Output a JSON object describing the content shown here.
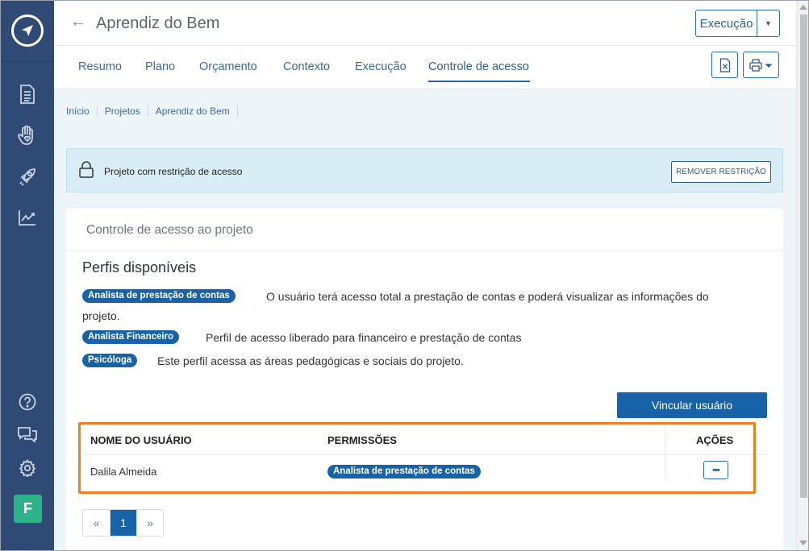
{
  "header": {
    "title": "Aprendiz do Bem",
    "status_button": "Execução"
  },
  "tabs": [
    {
      "label": "Resumo"
    },
    {
      "label": "Plano"
    },
    {
      "label": "Orçamento"
    },
    {
      "label": "Contexto"
    },
    {
      "label": "Execução"
    },
    {
      "label": "Controle de acesso",
      "active": true
    }
  ],
  "breadcrumb": [
    "Início",
    "Projetos",
    "Aprendiz do Bem"
  ],
  "alert": {
    "message": "Projeto com restrição de acesso",
    "button": "REMOVER RESTRIÇÃO"
  },
  "card": {
    "title": "Controle de acesso ao projeto",
    "profiles_title": "Perfis disponíveis",
    "profiles": [
      {
        "name": "Analista de prestação de contas",
        "description": "O usuário terá acesso total a prestação de contas e poderá visualizar as informações do",
        "description_cont": "projeto."
      },
      {
        "name": "Analista Financeiro",
        "description": "Perfil de acesso liberado para financeiro e prestação de contas"
      },
      {
        "name": "Psicóloga",
        "description": "Este perfil acessa as áreas pedagógicas e sociais do projeto."
      }
    ],
    "link_button": "Vincular usuário"
  },
  "table": {
    "headers": {
      "user": "NOME DO USUÁRIO",
      "permissions": "PERMISSÕES",
      "actions": "AÇÕES"
    },
    "rows": [
      {
        "user": "Dalila Almeida",
        "permission": "Analista de prestação de contas",
        "actions_label": "•••"
      }
    ]
  },
  "pagination": {
    "prev": "«",
    "current": "1",
    "next": "»"
  },
  "sidebar": {
    "icons": [
      "document-icon",
      "hand-heart-icon",
      "rocket-icon",
      "chart-line-icon",
      "help-icon",
      "chat-icon",
      "gear-icon"
    ],
    "avatar_letter": "F"
  },
  "colors": {
    "sidebar": "#2f4a75",
    "primary": "#1862a8",
    "highlight": "#f07f1e",
    "avatar": "#2db38a"
  }
}
